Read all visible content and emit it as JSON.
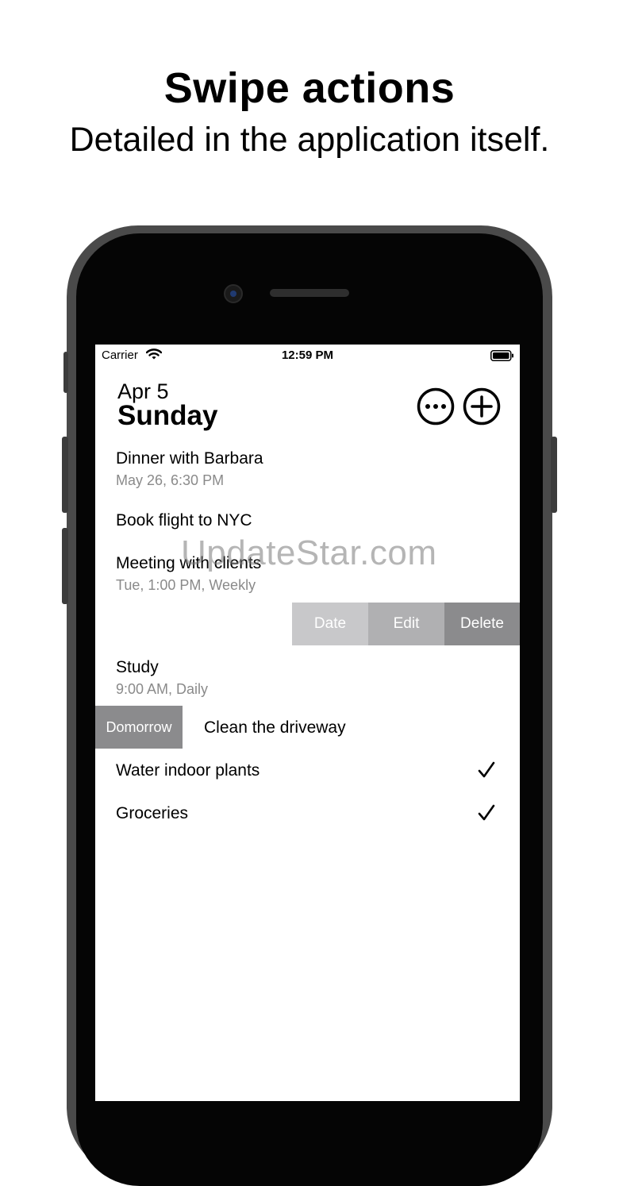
{
  "promo": {
    "headline": "Swipe actions",
    "subline": "Detailed in the application itself."
  },
  "status_bar": {
    "carrier": "Carrier",
    "time": "12:59 PM"
  },
  "header": {
    "date": "Apr 5",
    "weekday": "Sunday",
    "more_icon": "ellipsis-circle-icon",
    "add_icon": "plus-circle-icon"
  },
  "tasks": [
    {
      "title": "Dinner with Barbara",
      "subtitle": "May 26, 6:30 PM"
    },
    {
      "title": "Book flight to NYC"
    },
    {
      "title": "Meeting with clients",
      "subtitle": "Tue, 1:00 PM, Weekly"
    },
    {
      "title": "Study",
      "subtitle": "9:00 AM, Daily"
    },
    {
      "title": "Clean the driveway"
    },
    {
      "title": "Water indoor plants",
      "done": true
    },
    {
      "title": "Groceries",
      "done": true
    }
  ],
  "swipe_actions": {
    "date": "Date",
    "edit": "Edit",
    "delete": "Delete",
    "tomorrow": "Domorrow"
  },
  "watermark": "UpdateStar.com",
  "colors": {
    "phone_frame": "#4a4a4a",
    "action_light": "#c8c8ca",
    "action_mid": "#b0b0b2",
    "action_dark": "#8b8b8d",
    "subtitle_gray": "#8a8a8a"
  }
}
